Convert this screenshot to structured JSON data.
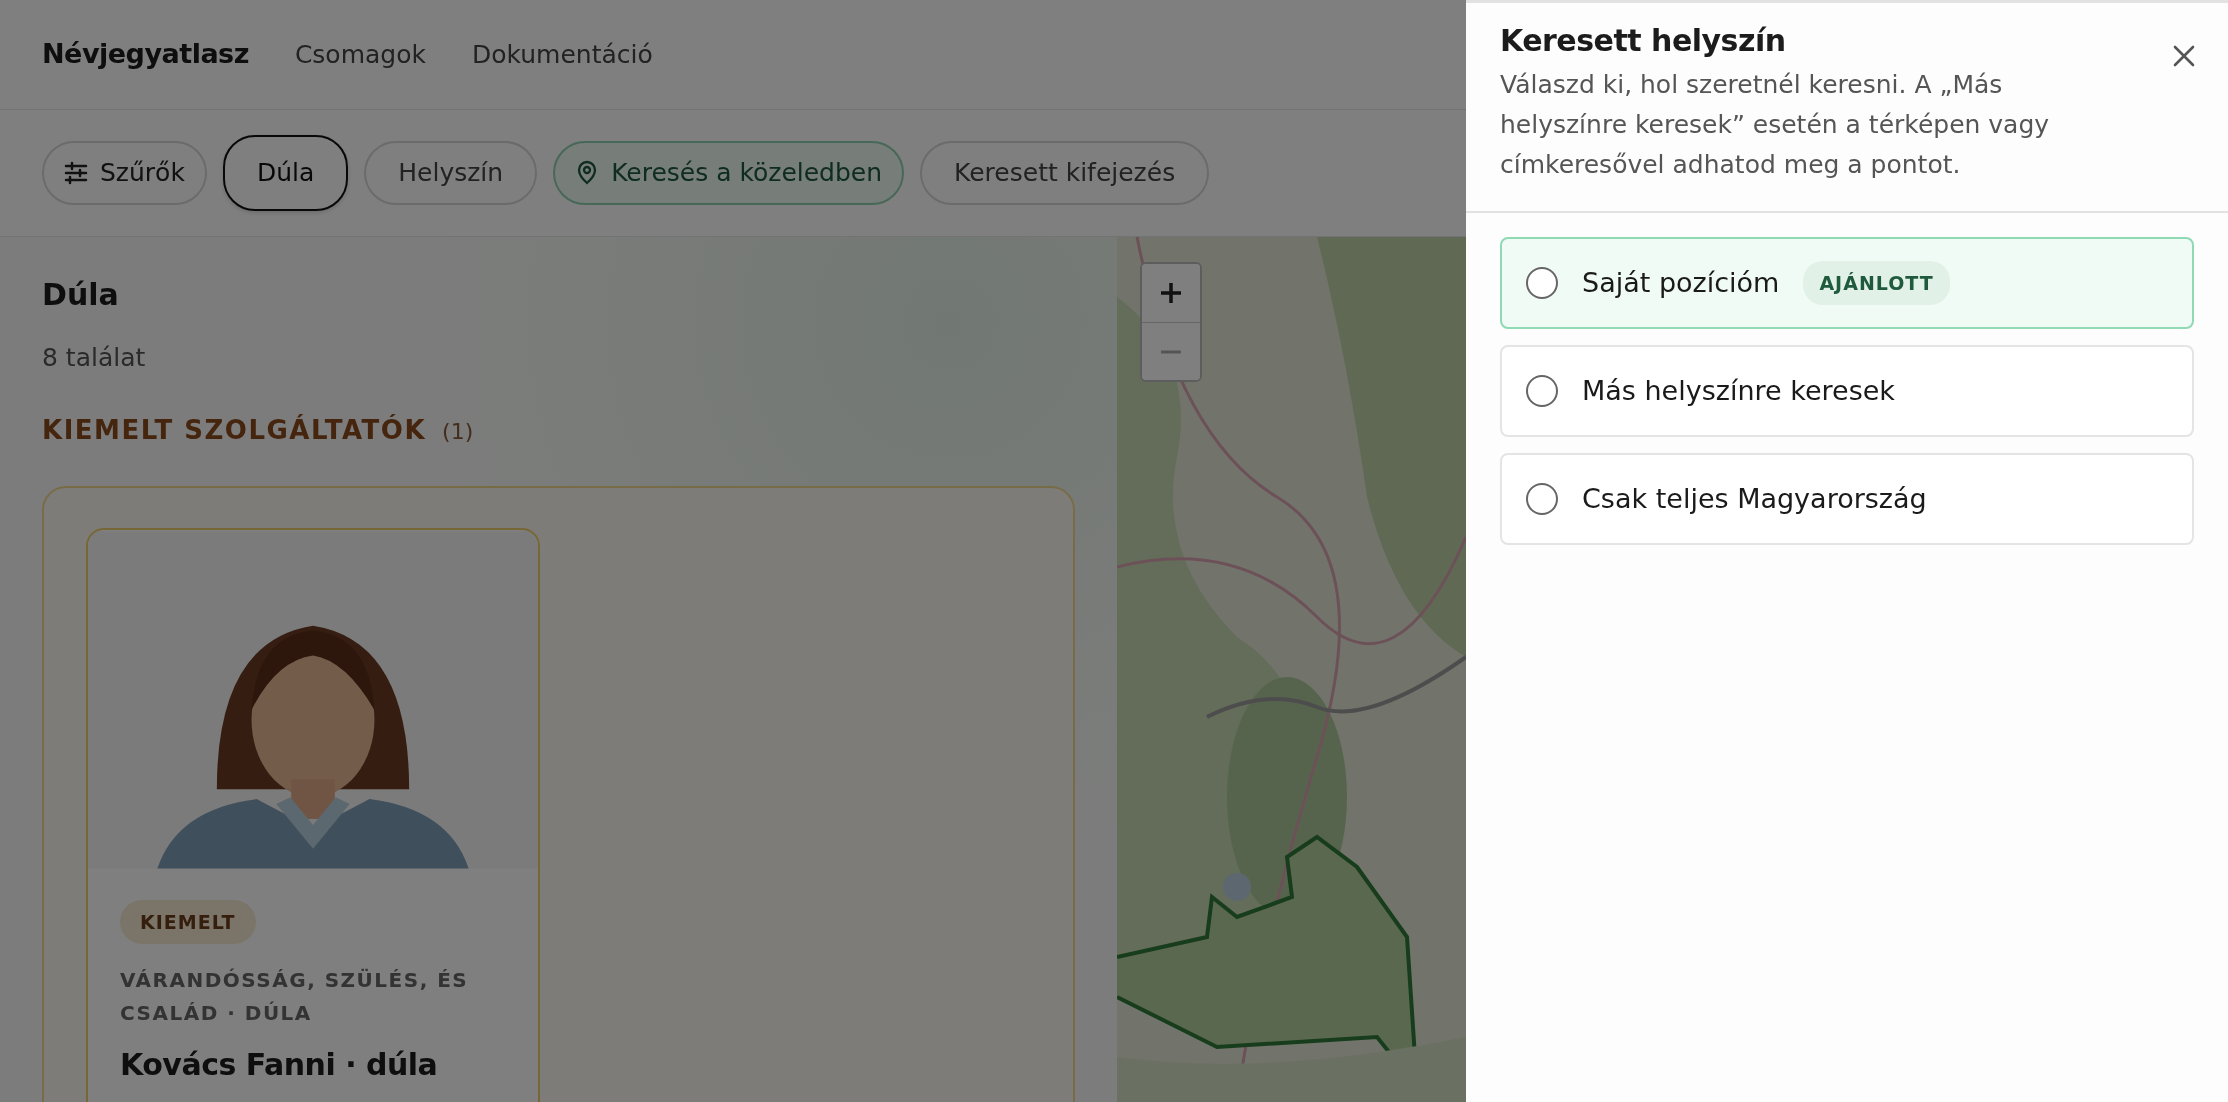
{
  "nav": {
    "brand": "Névjegyatlasz",
    "links": [
      "Csomagok",
      "Dokumentáció"
    ]
  },
  "filters": [
    {
      "kind": "filters",
      "label": "Szűrők",
      "selected": false
    },
    {
      "kind": "chip",
      "label": "Dúla",
      "selected": true
    },
    {
      "kind": "chip",
      "label": "Helyszín",
      "selected": false
    },
    {
      "kind": "nearby",
      "label": "Keresés a közeledben",
      "selected": false
    },
    {
      "kind": "chip",
      "label": "Keresett kifejezés",
      "selected": false
    }
  ],
  "results": {
    "title": "Dúla",
    "count": "8 találat",
    "section": {
      "title": "KIEMELT SZOLGÁLTATÓK",
      "count": "(1)"
    },
    "cards": [
      {
        "badge": "KIEMELT",
        "category": "VÁRANDÓSSÁG, SZÜLÉS, ÉS CSALÁD · DÚLA",
        "name": "Kovács Fanni · dúla"
      }
    ]
  },
  "drawer": {
    "title": "Keresett helyszín",
    "description": "Válaszd ki, hol szeretnél keresni. A „Más helyszínre keresek” esetén a térképen vagy címkeresővel adhatod meg a pontot.",
    "options": [
      {
        "label": "Saját pozícióm",
        "badge": "AJÁNLOTT",
        "recommended": true,
        "selected": false
      },
      {
        "label": "Más helyszínre keresek",
        "recommended": false,
        "selected": false
      },
      {
        "label": "Csak teljes Magyarország",
        "recommended": false,
        "selected": false
      }
    ]
  }
}
